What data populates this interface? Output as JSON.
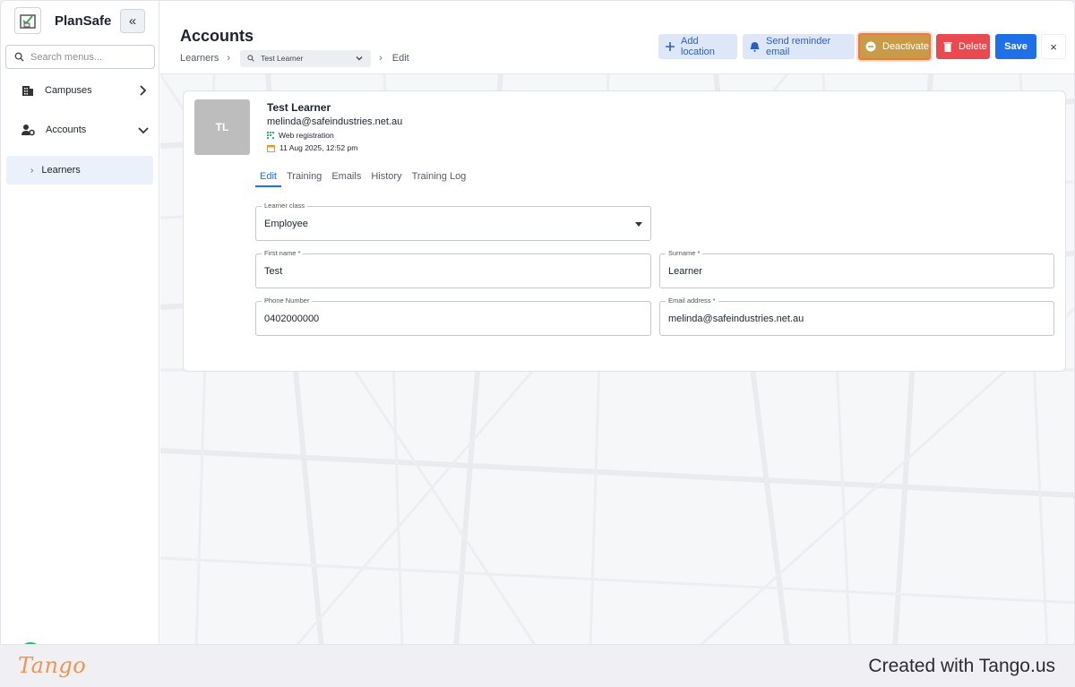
{
  "app": {
    "brand": "PlanSafe"
  },
  "sidebar": {
    "search_placeholder": "Search menus...",
    "items": [
      {
        "label": "Campuses",
        "icon": "building-icon",
        "expanded": false
      },
      {
        "label": "Accounts",
        "icon": "users-gear-icon",
        "expanded": true
      }
    ],
    "sub_items": [
      {
        "label": "Learners",
        "selected": true
      }
    ]
  },
  "header": {
    "title": "Accounts",
    "breadcrumb": {
      "root": "Learners",
      "selector_value": "Test Learner",
      "current": "Edit"
    },
    "actions": {
      "add_location": "Add location",
      "send_reminder": "Send reminder email",
      "deactivate": "Deactivate",
      "delete": "Delete",
      "save": "Save",
      "close": "×"
    }
  },
  "profile": {
    "initials": "TL",
    "name": "Test Learner",
    "email": "melinda@safeindustries.net.au",
    "registration": "Web registration",
    "date": "11 Aug 2025, 12:52 pm"
  },
  "tabs": [
    "Edit",
    "Training",
    "Emails",
    "History",
    "Training Log"
  ],
  "active_tab": "Edit",
  "form": {
    "learner_class": {
      "label": "Learner class",
      "value": "Employee"
    },
    "first_name": {
      "label": "First name *",
      "value": "Test"
    },
    "surname": {
      "label": "Surname *",
      "value": "Learner"
    },
    "phone": {
      "label": "Phone Number",
      "value": "0402000000"
    },
    "email": {
      "label": "Email address *",
      "value": "melinda@safeindustries.net.au"
    }
  },
  "footer": {
    "logo": "Tango",
    "created": "Created with Tango.us"
  },
  "colors": {
    "primary": "#1e6fe8",
    "danger": "#e94a50",
    "deactivate": "#c99a47",
    "highlight": "#f07a3a",
    "tango": "#f29350"
  }
}
